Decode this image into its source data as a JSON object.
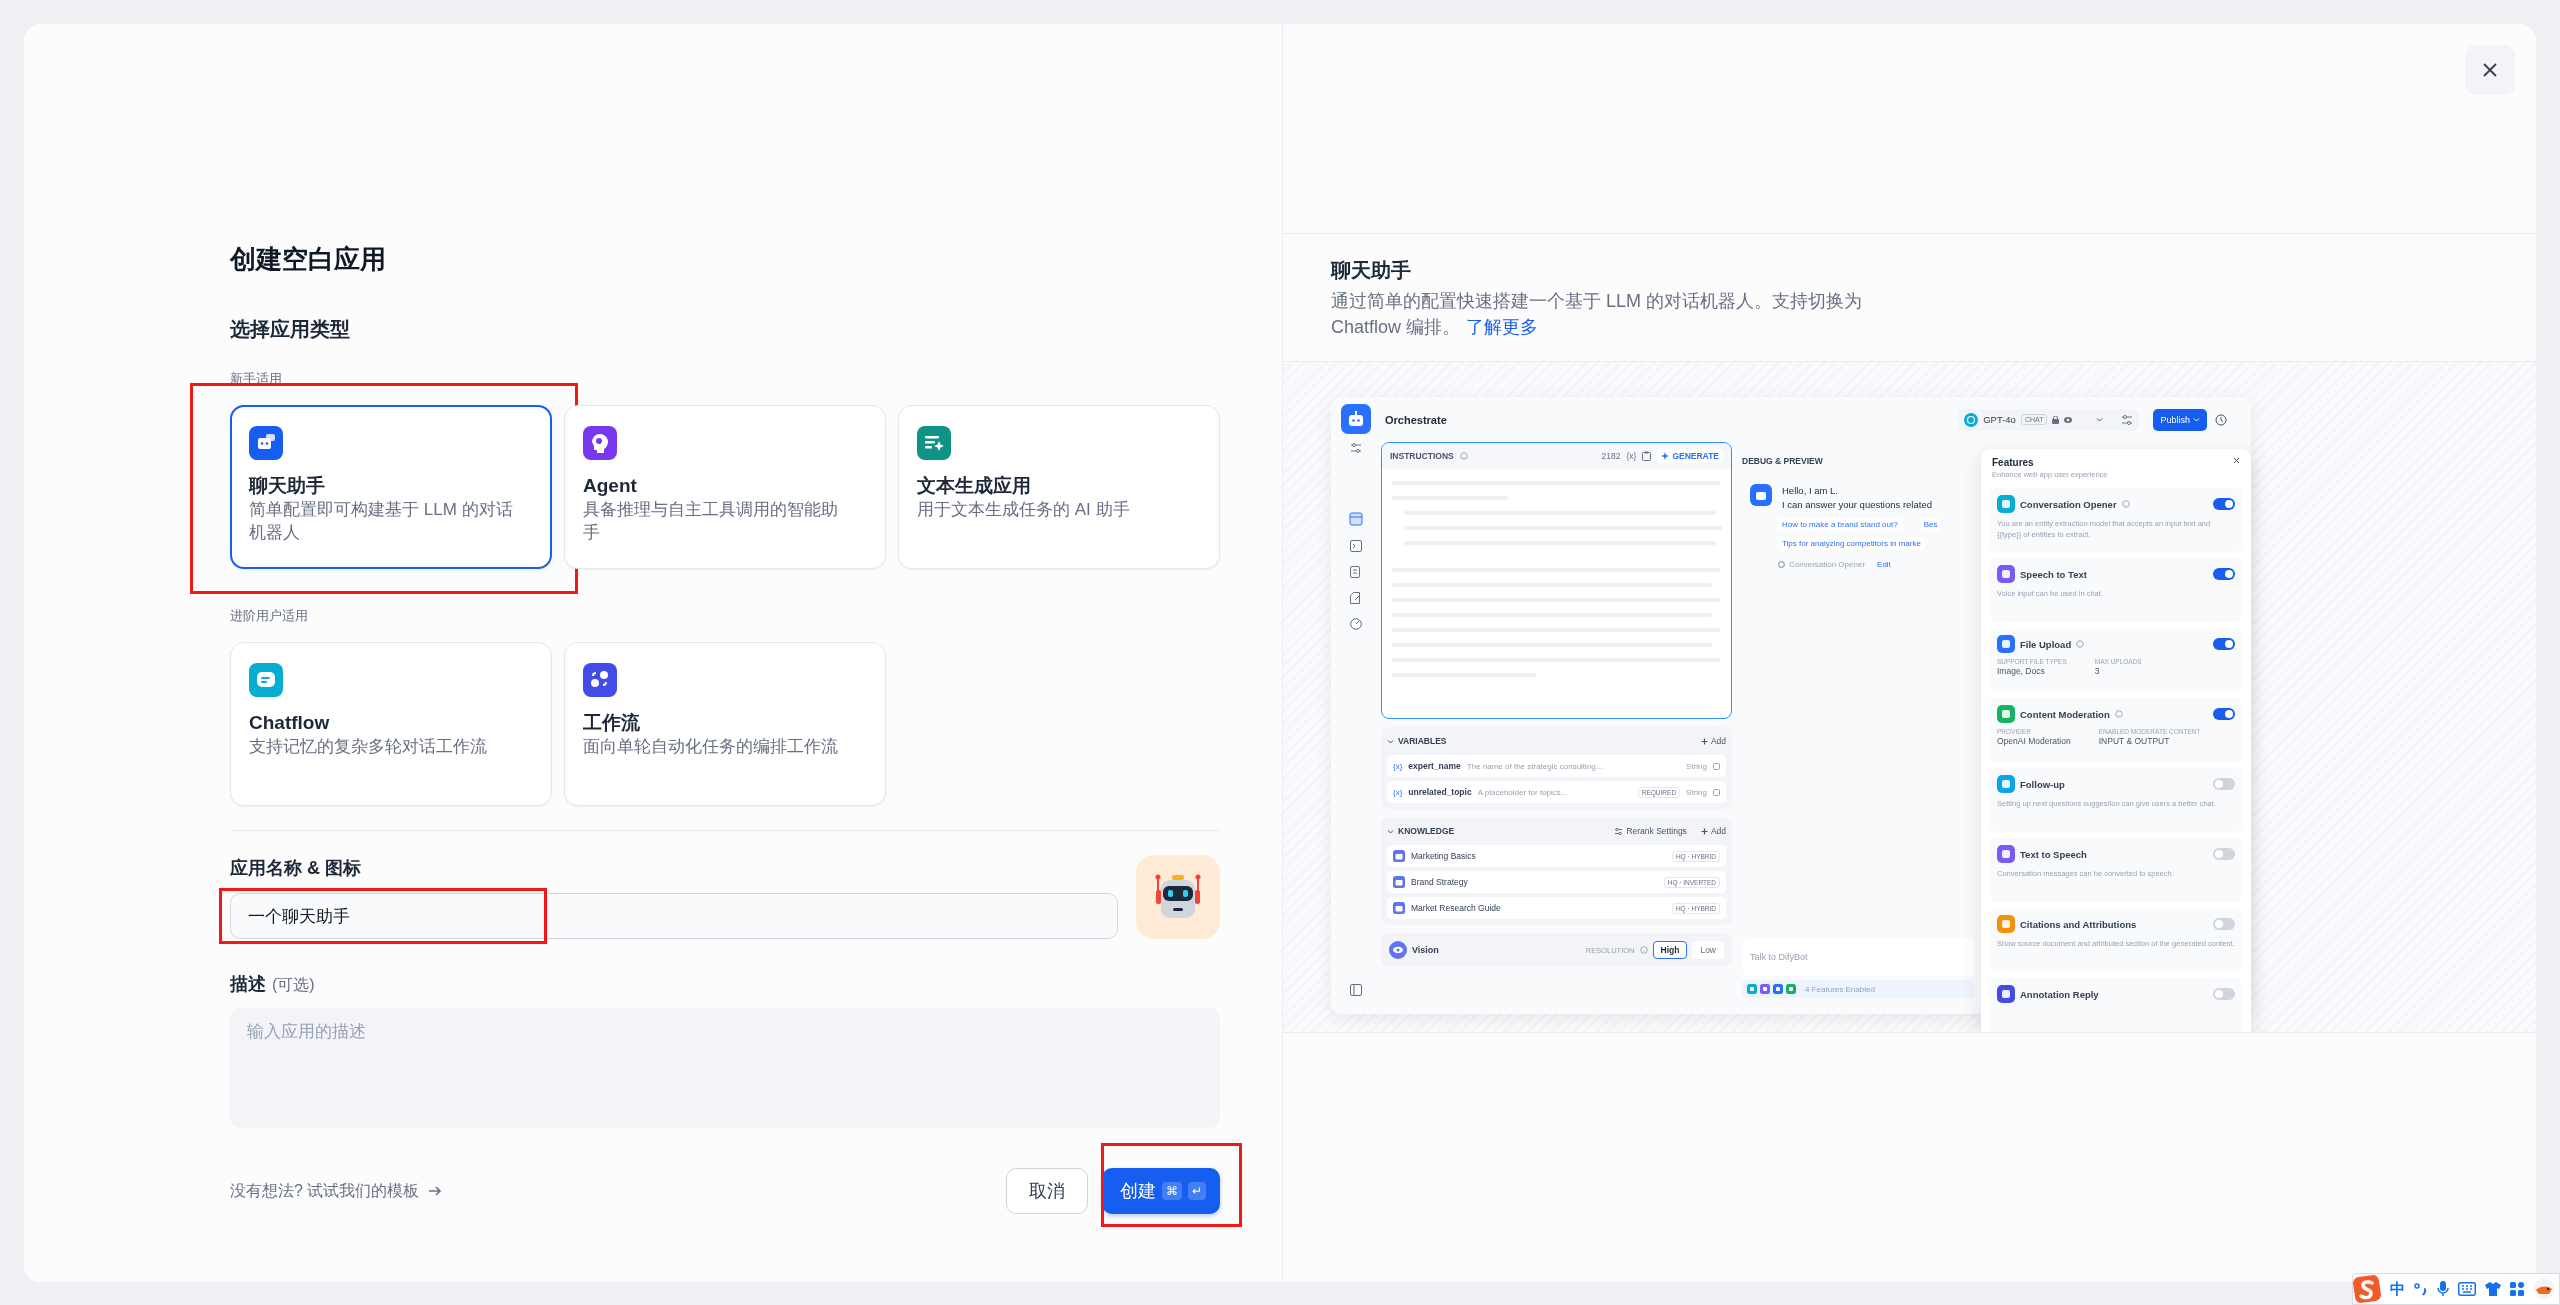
{
  "left": {
    "title": "创建空白应用",
    "type_heading": "选择应用类型",
    "groups": [
      {
        "label": "新手适用",
        "cards": [
          {
            "kind": "chat",
            "color": "#155eef",
            "title": "聊天助手",
            "description": "简单配置即可构建基于 LLM 的对话机器人",
            "selected": true,
            "highlighted": true
          },
          {
            "kind": "agent",
            "color": "#7839ee",
            "title": "Agent",
            "description": "具备推理与自主工具调用的智能助手",
            "selected": false,
            "highlighted": false
          },
          {
            "kind": "text",
            "color": "#0e9384",
            "title": "文本生成应用",
            "description": "用于文本生成任务的 AI 助手",
            "selected": false,
            "highlighted": false
          }
        ]
      },
      {
        "label": "进阶用户适用",
        "cards": [
          {
            "kind": "chatflow",
            "color": "#06aed4",
            "title": "Chatflow",
            "description": "支持记忆的复杂多轮对话工作流",
            "selected": false,
            "highlighted": false
          },
          {
            "kind": "workflow",
            "color": "#444ce7",
            "title": "工作流",
            "description": "面向单轮自动化任务的编排工作流",
            "selected": false,
            "highlighted": false
          }
        ]
      }
    ],
    "name_label": "应用名称 & 图标",
    "name_value": "一个聊天助手",
    "name_highlighted": true,
    "description_label": "描述",
    "description_optional": "(可选)",
    "description_placeholder": "输入应用的描述",
    "template_link": "没有想法? 试试我们的模板",
    "cancel_button": "取消",
    "create_button": {
      "label": "创建",
      "keys": [
        "⌘",
        "↵"
      ],
      "highlighted": true
    }
  },
  "right": {
    "info": {
      "title": "聊天助手",
      "description": "通过简单的配置快速搭建一个基于 LLM 的对话机器人。支持切换为 Chatflow 编排。",
      "link": "了解更多"
    },
    "preview": {
      "title": "Orchestrate",
      "model": {
        "name": "GPT-4o",
        "mode": "CHAT"
      },
      "publish": "Publish",
      "instructions": {
        "label": "INSTRUCTIONS",
        "count": "2182",
        "token": "{x}",
        "generate": "GENERATE"
      },
      "variables": {
        "label": "VARIABLES",
        "add": "Add",
        "items": [
          {
            "token": "{x}",
            "name": "expert_name",
            "description": "The name of the strategic consulting...",
            "type": "String"
          },
          {
            "token": "{x}",
            "name": "unrelated_topic",
            "description": "A placeholder for topics...",
            "badge": "REQUIRED",
            "type": "String"
          }
        ]
      },
      "knowledge": {
        "label": "KNOWLEDGE",
        "rerank": "Rerank Settings",
        "add": "Add",
        "items": [
          {
            "name": "Marketing Basics",
            "mode": "HQ · HYBRID"
          },
          {
            "name": "Brand Strategy",
            "mode": "HQ · INVERTED"
          },
          {
            "name": "Market Research Guide",
            "mode": "HQ · HYBRID"
          }
        ]
      },
      "vision": {
        "label": "Vision",
        "resolution_label": "RESOLUTION",
        "options": [
          {
            "label": "High",
            "selected": true
          },
          {
            "label": "Low",
            "selected": false
          }
        ]
      },
      "debug": {
        "title": "DEBUG & PREVIEW",
        "greeting": "Hello, I am L.",
        "message": "I can answer your questions related",
        "suggestions": [
          "How to make a brand stand out?",
          "Bes",
          "Tips for analyzing competitors in marke"
        ],
        "opener_label": "Conversation Opener",
        "edit": "Edit",
        "input_placeholder": "Talk to DifyBot",
        "features_enabled": "4 Features Enabled"
      },
      "features": {
        "title": "Features",
        "subtitle": "Enhance web app user experience",
        "items": [
          {
            "name": "Conversation Opener",
            "color": "#06aed4",
            "help": true,
            "on": true,
            "description": "You are an entity extraction model that accepts an input text and {{type}} of entities to extract."
          },
          {
            "name": "Speech to Text",
            "color": "#7a5af8",
            "help": false,
            "on": true,
            "description": "Voice input can be used in chat."
          },
          {
            "name": "File Upload",
            "color": "#2970ff",
            "help": true,
            "on": true,
            "fields": [
              {
                "label": "SUPPORT FILE TYPES",
                "value": "Image, Docs"
              },
              {
                "label": "MAX UPLOADS",
                "value": "3"
              }
            ]
          },
          {
            "name": "Content Moderation",
            "color": "#16b364",
            "help": true,
            "on": true,
            "fields": [
              {
                "label": "PROVIDER",
                "value": "OpenAI Moderation"
              },
              {
                "label": "ENABLED MODERATE CONTENT",
                "value": "INPUT & OUTPUT"
              }
            ]
          },
          {
            "name": "Follow-up",
            "color": "#0ba5ec",
            "help": false,
            "on": false,
            "description": "Setting up next questions suggestion can give users a better chat."
          },
          {
            "name": "Text to Speech",
            "color": "#7a5af8",
            "help": false,
            "on": false,
            "description": "Conversation messages can be converted to speech."
          },
          {
            "name": "Citations and Attributions",
            "color": "#f79009",
            "help": false,
            "on": false,
            "description": "Show source document and attributed section of the generated content."
          },
          {
            "name": "Annotation Reply",
            "color": "#444ce7",
            "help": false,
            "on": false
          }
        ]
      }
    }
  },
  "ime": {
    "language": "中"
  }
}
